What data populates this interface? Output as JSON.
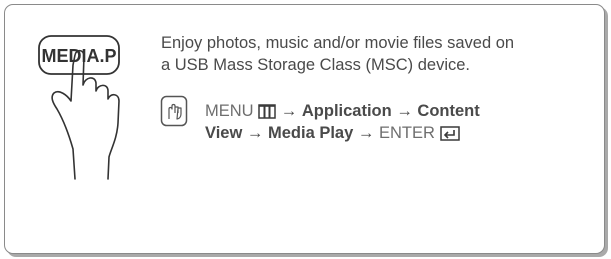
{
  "button_label": "MEDIA.P",
  "description": {
    "line1": "Enjoy photos, music and/or movie files saved on",
    "line2": "a USB Mass Storage Class (MSC) device."
  },
  "path": {
    "menu": "MENU",
    "arrow": "→",
    "application": "Application",
    "content_view_1": "Content",
    "content_view_2": "View",
    "media_play": "Media Play",
    "enter": "ENTER"
  },
  "icons": [
    "hand-pressing-button-icon",
    "remote-control-icon",
    "menu-grid-icon",
    "enter-key-icon"
  ]
}
